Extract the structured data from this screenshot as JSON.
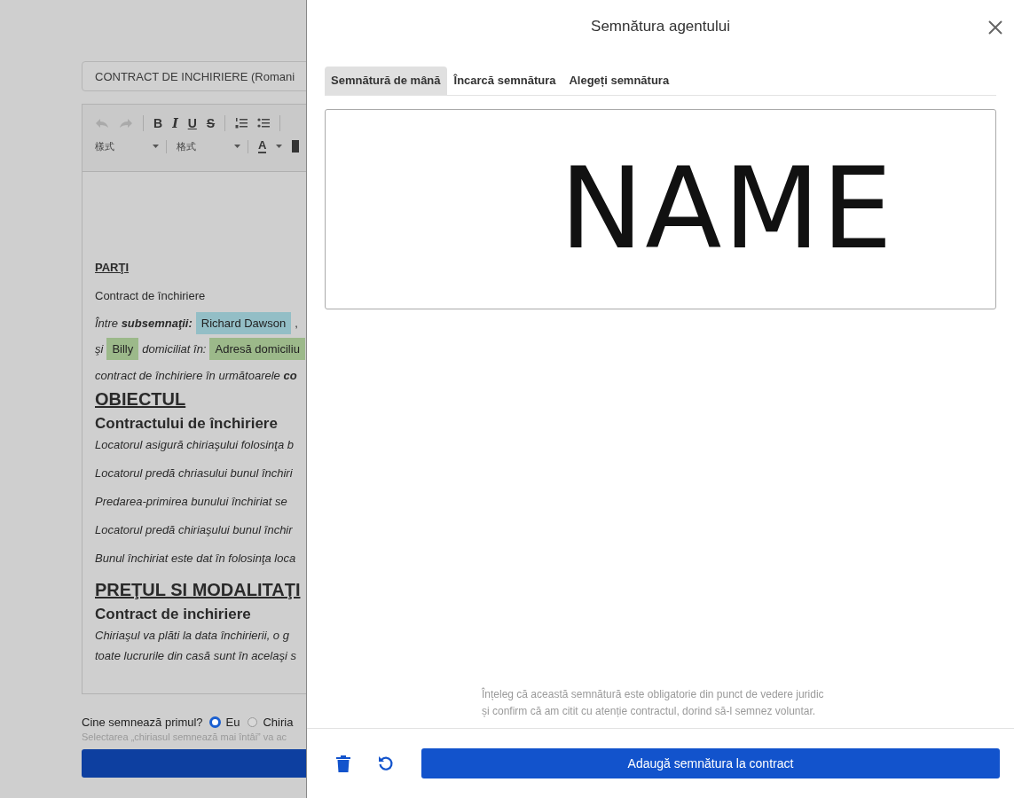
{
  "document": {
    "title_field": "CONTRACT DE INCHIRIERE (Romani",
    "toolbar": {
      "format_buttons": [
        "B",
        "I",
        "U",
        "S"
      ],
      "dropdowns": [
        "樣式",
        "格式"
      ],
      "font_color": "A"
    },
    "content": [
      {
        "kind": "label",
        "text": "PARŢI"
      },
      {
        "kind": "para",
        "text": "Contract de închiriere"
      },
      {
        "kind": "fields",
        "parts": [
          {
            "kind": "italic",
            "text": "Între **subsemnaţii:**"
          },
          {
            "kind": "chip",
            "text": "Richard Dawson",
            "color": "#93bec6"
          },
          {
            "kind": "plain",
            "text": ","
          }
        ]
      },
      {
        "kind": "fields",
        "parts": [
          {
            "kind": "italic",
            "text": "şi"
          },
          {
            "kind": "chip",
            "text": "Billy",
            "color": "#9cb98a"
          },
          {
            "kind": "italic",
            "text": "domiciliat în:"
          },
          {
            "kind": "chip",
            "text": "Adresă domiciliu",
            "color": "#9cb98a"
          }
        ]
      },
      {
        "kind": "italic_tight",
        "text": "contract de închiriere în următoarele **co**"
      },
      {
        "kind": "h1",
        "text": "OBIECTUL"
      },
      {
        "kind": "h2",
        "text": "Contractului de închiriere"
      },
      {
        "kind": "italic",
        "text": "Locatorul asigură chiriaşului folosinţa b"
      },
      {
        "kind": "italic",
        "text": "Locatorul predă chriasului bunul închiri"
      },
      {
        "kind": "italic",
        "text": "Predarea-primirea bunului închiriat se"
      },
      {
        "kind": "italic",
        "text": "Locatorul predă chiriaşului bunul închir"
      },
      {
        "kind": "italic",
        "text": "Bunul închiriat este dat în folosinţa loca"
      },
      {
        "kind": "h1",
        "text": "PREŢUL SI MODALITAŢI"
      },
      {
        "kind": "h2",
        "text": "Contract de inchiriere"
      },
      {
        "kind": "italic_tight",
        "text": "Chiriaşul va plăti la data închirierii, o g"
      },
      {
        "kind": "italic_tight",
        "text": "toate lucrurile din casă sunt în acelaşi s"
      }
    ],
    "signer_question": "Cine semnează primul?",
    "signer_options": [
      {
        "label": "Eu",
        "selected": true
      },
      {
        "label": "Chiria",
        "selected": false
      }
    ],
    "signer_hint": "Selectarea „chiriasul semnează mai întâi” va ac"
  },
  "drawer": {
    "title": "Semnătura agentului",
    "tabs": [
      {
        "label": "Semnătură de mână",
        "selected": true
      },
      {
        "label": "Încarcă semnătura",
        "selected": false
      },
      {
        "label": "Alegeți semnătura",
        "selected": false
      }
    ],
    "signature": "NAME",
    "consent": [
      "Înțeleg că această semnătură este obligatorie din punct de vedere juridic",
      "și confirm că am citit cu atenție contractul, dorind să-l semnez voluntar."
    ],
    "submit_button": "Adaugă semnătura la contract"
  }
}
